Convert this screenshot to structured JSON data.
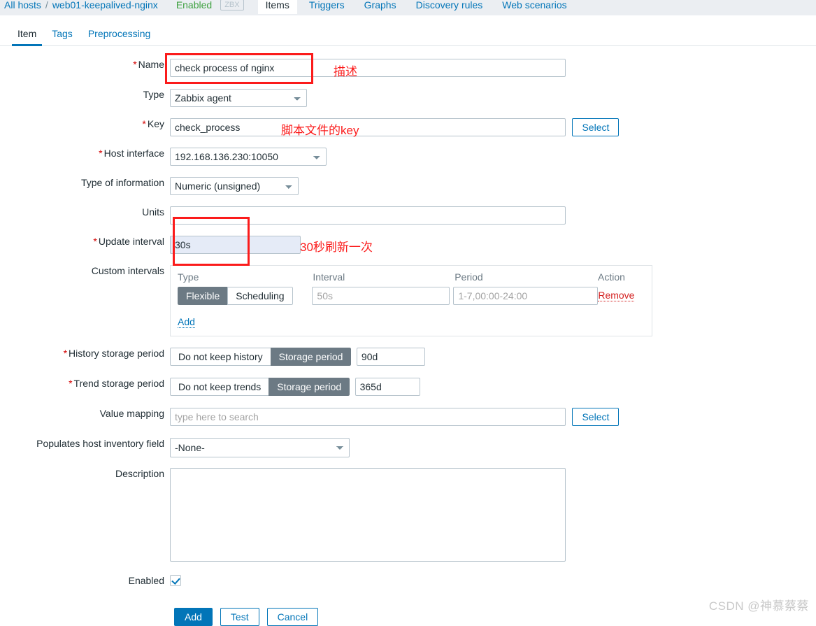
{
  "topbar": {
    "breadcrumb_root": "All hosts",
    "breadcrumb_sep": "/",
    "breadcrumb_host": "web01-keepalived-nginx",
    "status": "Enabled",
    "zbx_chip": "ZBX",
    "nav": [
      {
        "label": "Items",
        "active": true
      },
      {
        "label": "Triggers",
        "active": false
      },
      {
        "label": "Graphs",
        "active": false
      },
      {
        "label": "Discovery rules",
        "active": false
      },
      {
        "label": "Web scenarios",
        "active": false
      }
    ]
  },
  "tabs": [
    {
      "label": "Item",
      "active": true
    },
    {
      "label": "Tags",
      "active": false
    },
    {
      "label": "Preprocessing",
      "active": false
    }
  ],
  "form": {
    "name": {
      "label": "Name",
      "required": true,
      "value": "check process of nginx"
    },
    "type": {
      "label": "Type",
      "required": false,
      "value": "Zabbix agent"
    },
    "key": {
      "label": "Key",
      "required": true,
      "value": "check_process",
      "select_label": "Select"
    },
    "host_interface": {
      "label": "Host interface",
      "required": true,
      "value": "192.168.136.230:10050"
    },
    "type_of_information": {
      "label": "Type of information",
      "required": false,
      "value": "Numeric (unsigned)"
    },
    "units": {
      "label": "Units",
      "required": false,
      "value": ""
    },
    "update_interval": {
      "label": "Update interval",
      "required": true,
      "value": "30s"
    },
    "custom_intervals": {
      "label": "Custom intervals",
      "headers": [
        "Type",
        "Interval",
        "Period",
        "Action"
      ],
      "rows": [
        {
          "type_options": [
            "Flexible",
            "Scheduling"
          ],
          "type_selected": "Flexible",
          "interval_placeholder": "50s",
          "interval_value": "",
          "period_placeholder": "1-7,00:00-24:00",
          "period_value": "",
          "action_label": "Remove"
        }
      ],
      "add_label": "Add"
    },
    "history_storage": {
      "label": "History storage period",
      "required": true,
      "options": [
        "Do not keep history",
        "Storage period"
      ],
      "selected": "Storage period",
      "value": "90d"
    },
    "trend_storage": {
      "label": "Trend storage period",
      "required": true,
      "options": [
        "Do not keep trends",
        "Storage period"
      ],
      "selected": "Storage period",
      "value": "365d"
    },
    "value_mapping": {
      "label": "Value mapping",
      "placeholder": "type here to search",
      "value": "",
      "select_label": "Select"
    },
    "inventory_field": {
      "label": "Populates host inventory field",
      "value": "-None-"
    },
    "description": {
      "label": "Description",
      "value": ""
    },
    "enabled": {
      "label": "Enabled",
      "checked": true
    }
  },
  "actions": [
    {
      "label": "Add",
      "style": "primary"
    },
    {
      "label": "Test",
      "style": "ghost"
    },
    {
      "label": "Cancel",
      "style": "ghost"
    }
  ],
  "annotations": [
    {
      "text": "描述"
    },
    {
      "text": "脚本文件的key"
    },
    {
      "text": "30秒刷新一次"
    }
  ],
  "watermark": "CSDN @神慕蔡蔡",
  "colors": {
    "link": "#0275b8",
    "annotation_red": "#fb1b1b",
    "required_red": "#d40000",
    "segment_active": "#6c7a84",
    "focus_field_bg": "#e5ebf7",
    "status_green": "#3fa141"
  }
}
